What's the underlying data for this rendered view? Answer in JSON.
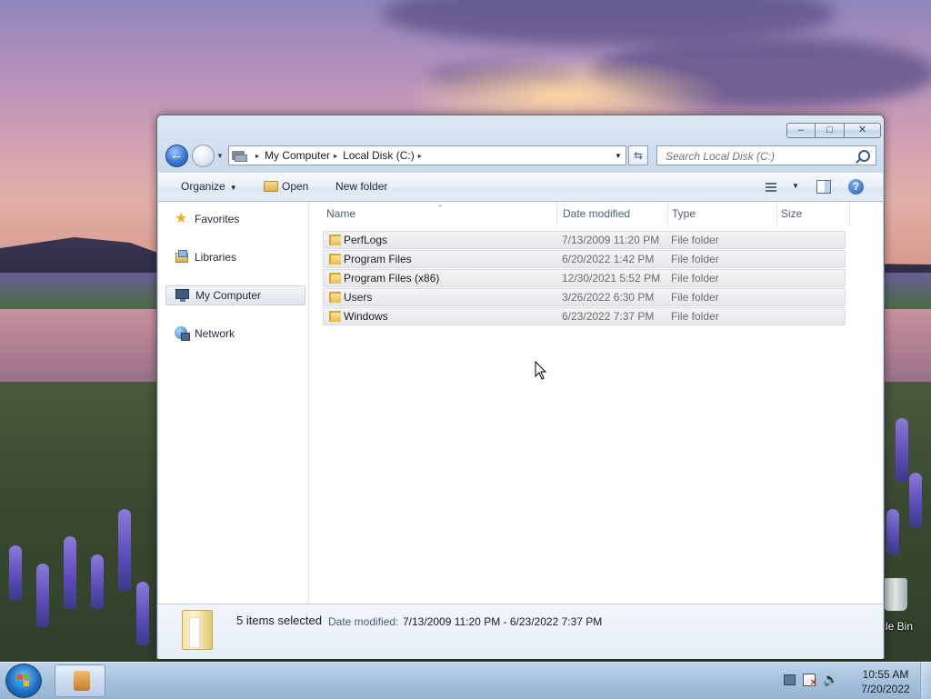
{
  "window": {
    "controls": {
      "minimize": "–",
      "maximize": "□",
      "close": "✕"
    }
  },
  "nav": {
    "back_glyph": "←",
    "address": {
      "crumbs": [
        "My Computer",
        "Local Disk (C:)"
      ],
      "separator": "▸",
      "dropdown": "▼"
    },
    "refresh_glyph": "⇆",
    "search": {
      "placeholder": "Search Local Disk (C:)",
      "value": ""
    }
  },
  "toolbar": {
    "organize": "Organize",
    "open": "Open",
    "new_folder": "New folder",
    "caret": "▼",
    "help": "?"
  },
  "sidebar": {
    "items": [
      {
        "label": "Favorites",
        "icon": "star-icon"
      },
      {
        "label": "Libraries",
        "icon": "libraries-icon"
      },
      {
        "label": "My Computer",
        "icon": "computer-icon",
        "selected": true
      },
      {
        "label": "Network",
        "icon": "network-icon"
      }
    ]
  },
  "files": {
    "columns": [
      "Name",
      "Date modified",
      "Type",
      "Size"
    ],
    "sort_glyph": "^",
    "rows": [
      {
        "name": "PerfLogs",
        "date": "7/13/2009 11:20 PM",
        "type": "File folder",
        "size": ""
      },
      {
        "name": "Program Files",
        "date": "6/20/2022 1:42 PM",
        "type": "File folder",
        "size": ""
      },
      {
        "name": "Program Files (x86)",
        "date": "12/30/2021 5:52 PM",
        "type": "File folder",
        "size": ""
      },
      {
        "name": "Users",
        "date": "3/26/2022 6:30 PM",
        "type": "File folder",
        "size": ""
      },
      {
        "name": "Windows",
        "date": "6/23/2022 7:37 PM",
        "type": "File folder",
        "size": ""
      }
    ]
  },
  "details": {
    "count": "5 items selected",
    "date_label": "Date modified:",
    "date_value": "7/13/2009 11:20 PM - 6/23/2022 7:37 PM"
  },
  "desktop": {
    "recycle_bin_label": "cle Bin"
  },
  "taskbar": {
    "clock_time": "10:55 AM",
    "clock_date": "7/20/2022",
    "volume_glyph": "🔊"
  },
  "colors": {
    "accent": "#3a78d6",
    "selection": "#e5e7ea",
    "taskbar": "#a7c3df"
  }
}
